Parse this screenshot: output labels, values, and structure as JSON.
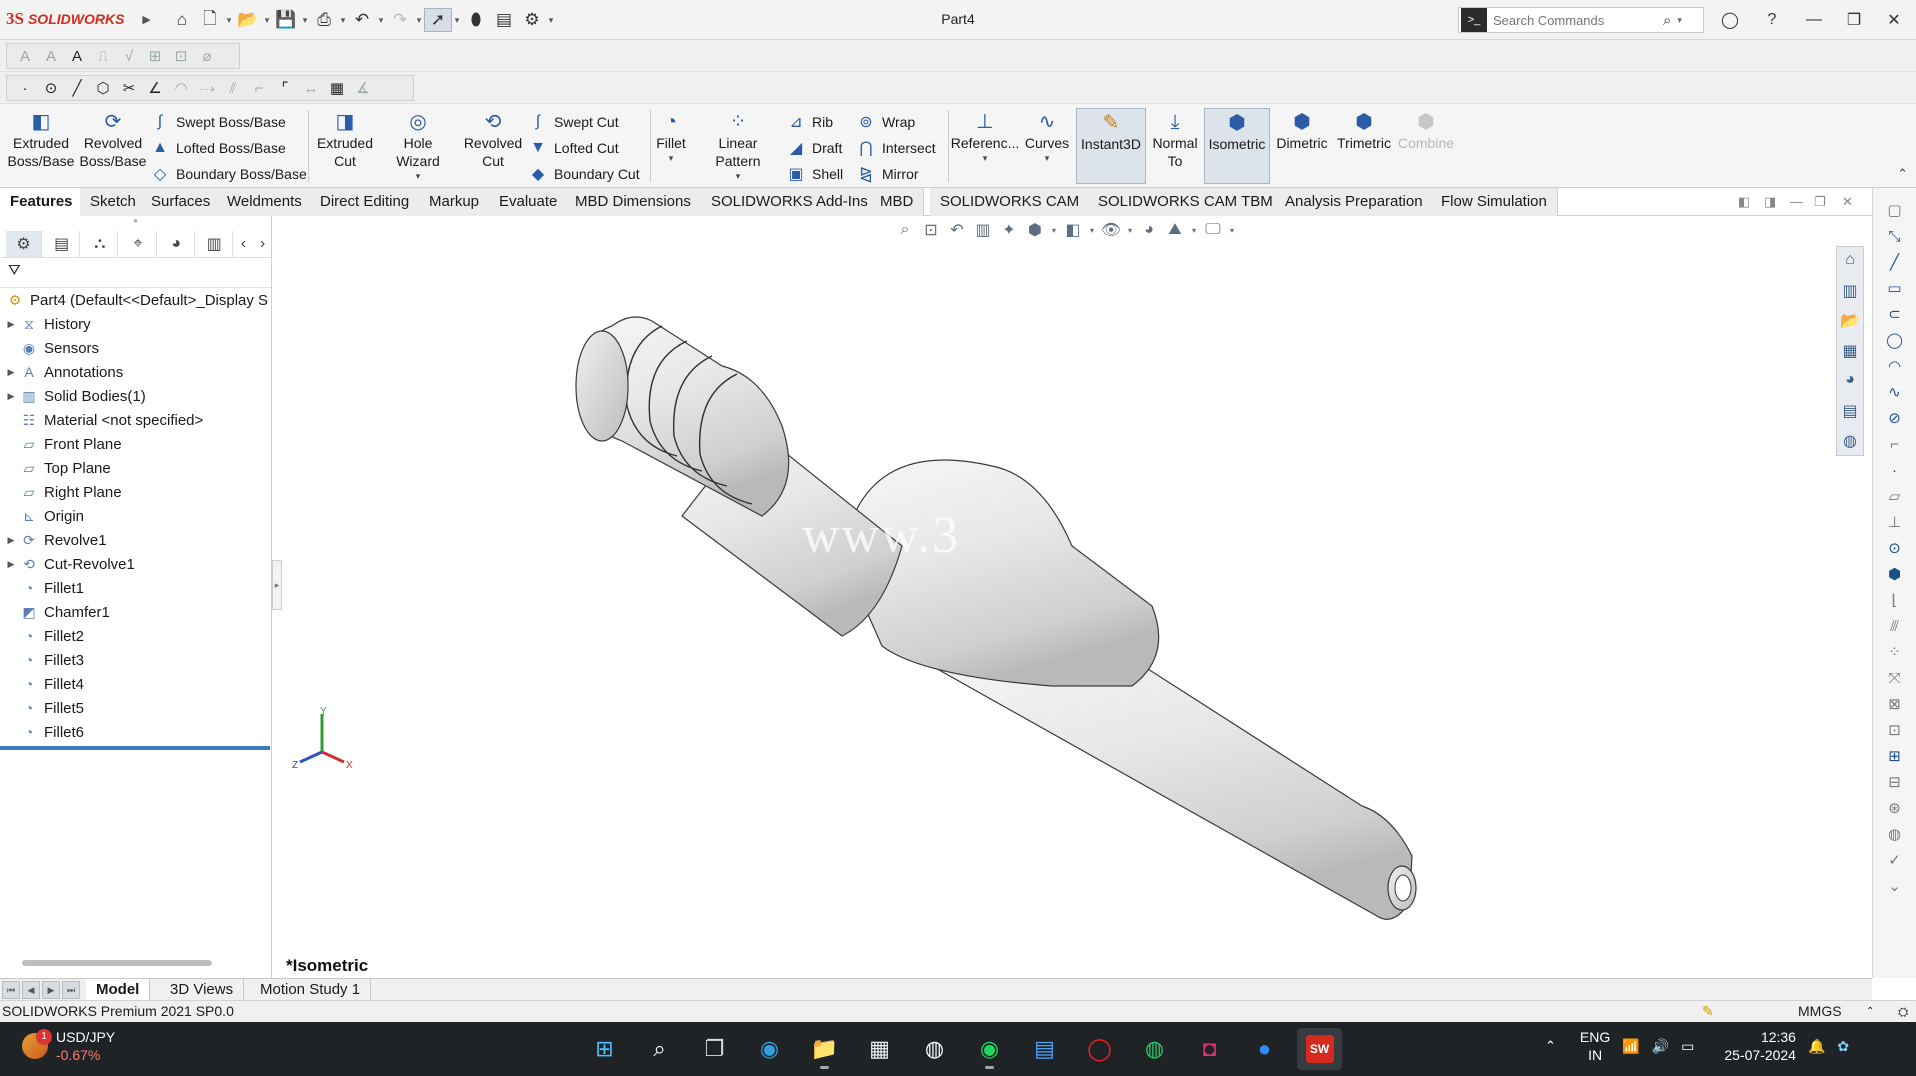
{
  "app": {
    "brand_ds": "3S",
    "brand_name": "SOLIDWORKS",
    "document_title": "Part4",
    "search_placeholder": "Search Commands"
  },
  "command_manager": {
    "buttons": {
      "extruded_boss": "Extruded Boss/Base",
      "revolved_boss": "Revolved Boss/Base",
      "swept_boss": "Swept Boss/Base",
      "lofted_boss": "Lofted Boss/Base",
      "boundary_boss": "Boundary Boss/Base",
      "extruded_cut": "Extruded Cut",
      "hole_wizard": "Hole Wizard",
      "revolved_cut": "Revolved Cut",
      "swept_cut": "Swept Cut",
      "lofted_cut": "Lofted Cut",
      "boundary_cut": "Boundary Cut",
      "fillet": "Fillet",
      "linear_pattern": "Linear Pattern",
      "rib": "Rib",
      "draft": "Draft",
      "shell": "Shell",
      "wrap": "Wrap",
      "intersect": "Intersect",
      "mirror": "Mirror",
      "reference": "Referenc...",
      "curves": "Curves",
      "instant3d": "Instant3D",
      "normal_to": "Normal To",
      "isometric": "Isometric",
      "dimetric": "Dimetric",
      "trimetric": "Trimetric",
      "combine": "Combine"
    }
  },
  "tabs": [
    "Features",
    "Sketch",
    "Surfaces",
    "Weldments",
    "Direct Editing",
    "Markup",
    "Evaluate",
    "MBD Dimensions",
    "SOLIDWORKS Add-Ins",
    "MBD",
    "SOLIDWORKS CAM",
    "SOLIDWORKS CAM TBM",
    "Analysis Preparation",
    "Flow Simulation"
  ],
  "feature_tree": {
    "root": "Part4  (Default<<Default>_Display S",
    "items": [
      {
        "label": "History",
        "expandable": true,
        "icon": "history-icon"
      },
      {
        "label": "Sensors",
        "expandable": false,
        "icon": "sensors-icon"
      },
      {
        "label": "Annotations",
        "expandable": true,
        "icon": "annotations-icon"
      },
      {
        "label": "Solid Bodies(1)",
        "expandable": true,
        "icon": "solid-bodies-icon"
      },
      {
        "label": "Material <not specified>",
        "expandable": false,
        "icon": "material-icon"
      },
      {
        "label": "Front Plane",
        "expandable": false,
        "icon": "plane-icon"
      },
      {
        "label": "Top Plane",
        "expandable": false,
        "icon": "plane-icon"
      },
      {
        "label": "Right Plane",
        "expandable": false,
        "icon": "plane-icon"
      },
      {
        "label": "Origin",
        "expandable": false,
        "icon": "origin-icon"
      },
      {
        "label": "Revolve1",
        "expandable": true,
        "icon": "revolve-icon"
      },
      {
        "label": "Cut-Revolve1",
        "expandable": true,
        "icon": "cut-revolve-icon"
      },
      {
        "label": "Fillet1",
        "expandable": false,
        "icon": "fillet-icon"
      },
      {
        "label": "Chamfer1",
        "expandable": false,
        "icon": "chamfer-icon"
      },
      {
        "label": "Fillet2",
        "expandable": false,
        "icon": "fillet-icon"
      },
      {
        "label": "Fillet3",
        "expandable": false,
        "icon": "fillet-icon"
      },
      {
        "label": "Fillet4",
        "expandable": false,
        "icon": "fillet-icon"
      },
      {
        "label": "Fillet5",
        "expandable": false,
        "icon": "fillet-icon"
      },
      {
        "label": "Fillet6",
        "expandable": false,
        "icon": "fillet-icon"
      }
    ]
  },
  "viewport": {
    "view_name": "*Isometric",
    "watermark": "www.3",
    "axis_labels": {
      "x": "X",
      "y": "Y",
      "z": "Z"
    }
  },
  "bottom_tabs": [
    "Model",
    "3D Views",
    "Motion Study 1"
  ],
  "status": {
    "left": "SOLIDWORKS Premium 2021 SP0.0",
    "units": "MMGS"
  },
  "taskbar": {
    "ticker_symbol": "USD/JPY",
    "ticker_change": "-0.67%",
    "ticker_badge": "1",
    "language_1": "ENG",
    "language_2": "IN",
    "time": "12:36",
    "date": "25-07-2024",
    "solidworks_badge": "SW"
  },
  "colors": {
    "brand_red": "#d52b1e",
    "active_blue": "#3a7bbf",
    "taskbar_bg": "#1f2326"
  }
}
